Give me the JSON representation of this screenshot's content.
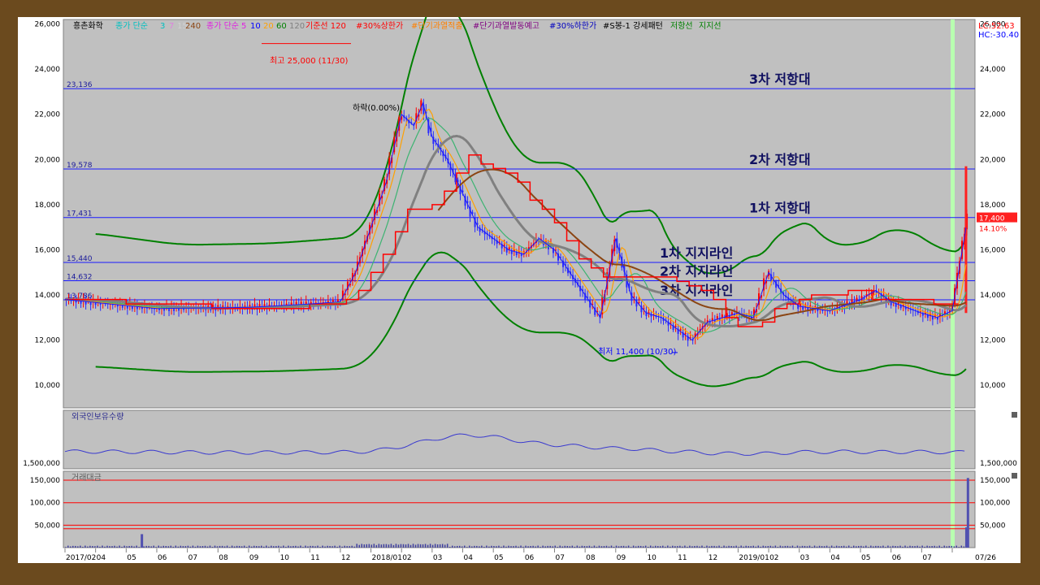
{
  "legend": {
    "stock": "흥촌화학",
    "ma_group": "종가 단순",
    "ma_periods": [
      "3",
      "7",
      "15",
      "240"
    ],
    "ma_group2": "종가 단순",
    "ma_periods2": [
      "5",
      "10",
      "20",
      "60",
      "120"
    ],
    "base_line": "기준선 120",
    "items": [
      "#30%상한가",
      "#단기과열적출",
      "#단기과열발동예고",
      "#30%하한가",
      "#S봉-1 강세패턴",
      "저항선",
      "지지선"
    ]
  },
  "top_right": {
    "lc": "LC:52.63",
    "hc": "HC:-30.40"
  },
  "colors": {
    "background": "#c0c0c0",
    "price_up": "#ff0000",
    "price_down": "#2a2aff",
    "bollinger": "#008000",
    "reference": "#1a1aff",
    "ma240": "#808080",
    "ma120": "#8b4513",
    "baseline": "#ff0000",
    "current": "#ff2020",
    "highlight": "#b8ffb0"
  },
  "chart_data": [
    {
      "type": "candlestick",
      "name": "price",
      "y_ticks": [
        "26,000",
        "24,000",
        "22,000",
        "20,000",
        "18,000",
        "16,000",
        "14,000",
        "12,000",
        "10,000"
      ],
      "y_tick_values": [
        26000,
        24000,
        22000,
        20000,
        18000,
        16000,
        14000,
        12000,
        10000
      ],
      "ylim": [
        9000,
        26200
      ],
      "x_ticks": [
        "2017/02",
        "04",
        "05",
        "06",
        "07",
        "08",
        "09",
        "10",
        "11",
        "12",
        "2018/01",
        "02",
        "03",
        "04",
        "05",
        "06",
        "07",
        "08",
        "09",
        "10",
        "11",
        "12",
        "2019/01",
        "02",
        "03",
        "04",
        "05",
        "06",
        "07",
        "07/26"
      ],
      "close_path": [
        [
          0,
          13800
        ],
        [
          3,
          13400
        ],
        [
          6,
          13450
        ],
        [
          8,
          13600
        ],
        [
          9,
          13700
        ],
        [
          9.5,
          15000
        ],
        [
          10,
          17000
        ],
        [
          10.5,
          19000
        ],
        [
          11,
          22000
        ],
        [
          11.4,
          21500
        ],
        [
          11.7,
          22500
        ],
        [
          12,
          21000
        ],
        [
          12.5,
          20000
        ],
        [
          13,
          18500
        ],
        [
          13.5,
          17000
        ],
        [
          14,
          16500
        ],
        [
          14.5,
          16000
        ],
        [
          15,
          15800
        ],
        [
          15.5,
          16500
        ],
        [
          16,
          16000
        ],
        [
          16.5,
          15000
        ],
        [
          17,
          14000
        ],
        [
          17.5,
          13000
        ],
        [
          18,
          16500
        ],
        [
          18.5,
          14000
        ],
        [
          19,
          13200
        ],
        [
          19.5,
          13000
        ],
        [
          20,
          12500
        ],
        [
          20.5,
          12000
        ],
        [
          21,
          12800
        ],
        [
          21.5,
          13000
        ],
        [
          22,
          13200
        ],
        [
          22.5,
          13000
        ],
        [
          23,
          15000
        ],
        [
          23.5,
          14000
        ],
        [
          24,
          13500
        ],
        [
          25,
          13300
        ],
        [
          26,
          13800
        ],
        [
          26.5,
          14200
        ],
        [
          27,
          13700
        ],
        [
          28,
          13200
        ],
        [
          28.5,
          13000
        ],
        [
          29,
          13300
        ],
        [
          29.5,
          17400
        ]
      ],
      "high_label": "최고 25,000 (11/30)",
      "low_label": "최저 11,400 (10/30)",
      "annotation": "하락(0.00%)",
      "reference_lines": [
        {
          "value": 23136,
          "label": "23,136",
          "name": "3차 저항대"
        },
        {
          "value": 19578,
          "label": "19,578",
          "name": "2차 저항대"
        },
        {
          "value": 17431,
          "label": "17,431",
          "name": "1차 저항대"
        },
        {
          "value": 15440,
          "label": "15,440",
          "name": "1차 지지라인"
        },
        {
          "value": 14632,
          "label": "14,632",
          "name": "2차 지지라인"
        },
        {
          "value": 13786,
          "label": "13,786",
          "name": "3차 지지라인"
        }
      ],
      "current_price": "17,400",
      "current_change": "14.10%"
    },
    {
      "type": "line",
      "name": "외국인보유수량",
      "y_tick": "1,500,000"
    },
    {
      "type": "bar",
      "name": "거래대금",
      "y_ticks": [
        "150,000",
        "100,000",
        "50,000"
      ],
      "y_tick_values": [
        150000,
        100000,
        50000
      ],
      "ylim": [
        0,
        170000
      ],
      "bars": [
        [
          2.5,
          30000
        ],
        [
          29.5,
          155000
        ],
        [
          29.45,
          45000
        ]
      ]
    }
  ]
}
